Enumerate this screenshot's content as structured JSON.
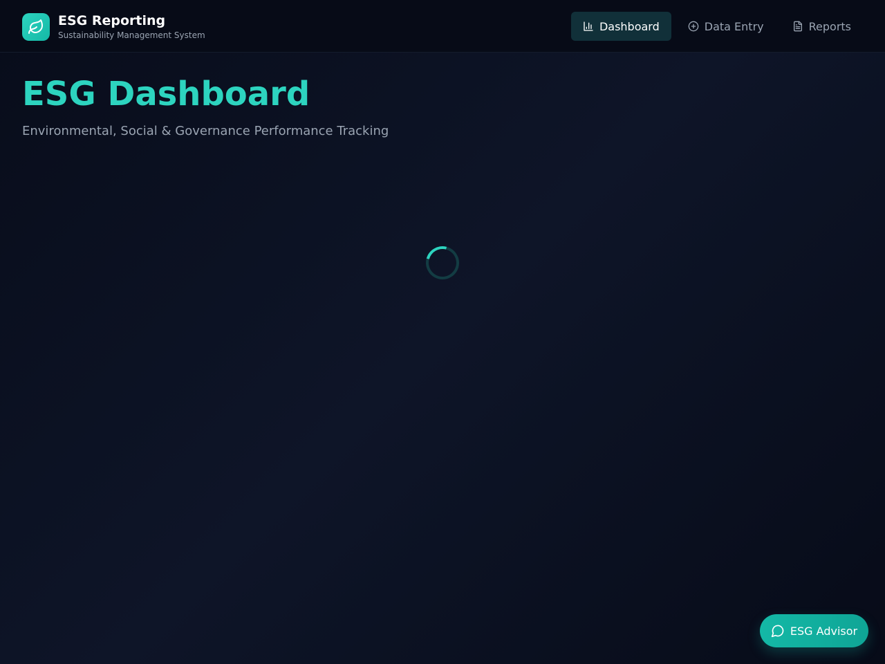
{
  "app": {
    "title": "ESG Reporting",
    "subtitle": "Sustainability Management System",
    "logo_icon": "leaf-icon",
    "accent_color": "#2dd4bf"
  },
  "nav": {
    "items": [
      {
        "label": "Dashboard",
        "icon": "bar-chart-icon",
        "active": true
      },
      {
        "label": "Data Entry",
        "icon": "plus-circle-icon",
        "active": false
      },
      {
        "label": "Reports",
        "icon": "file-text-icon",
        "active": false
      }
    ]
  },
  "page": {
    "title": "ESG Dashboard",
    "subtitle": "Environmental, Social & Governance Performance Tracking",
    "state": "loading"
  },
  "advisor": {
    "label": "ESG Advisor",
    "icon": "message-circle-icon"
  }
}
